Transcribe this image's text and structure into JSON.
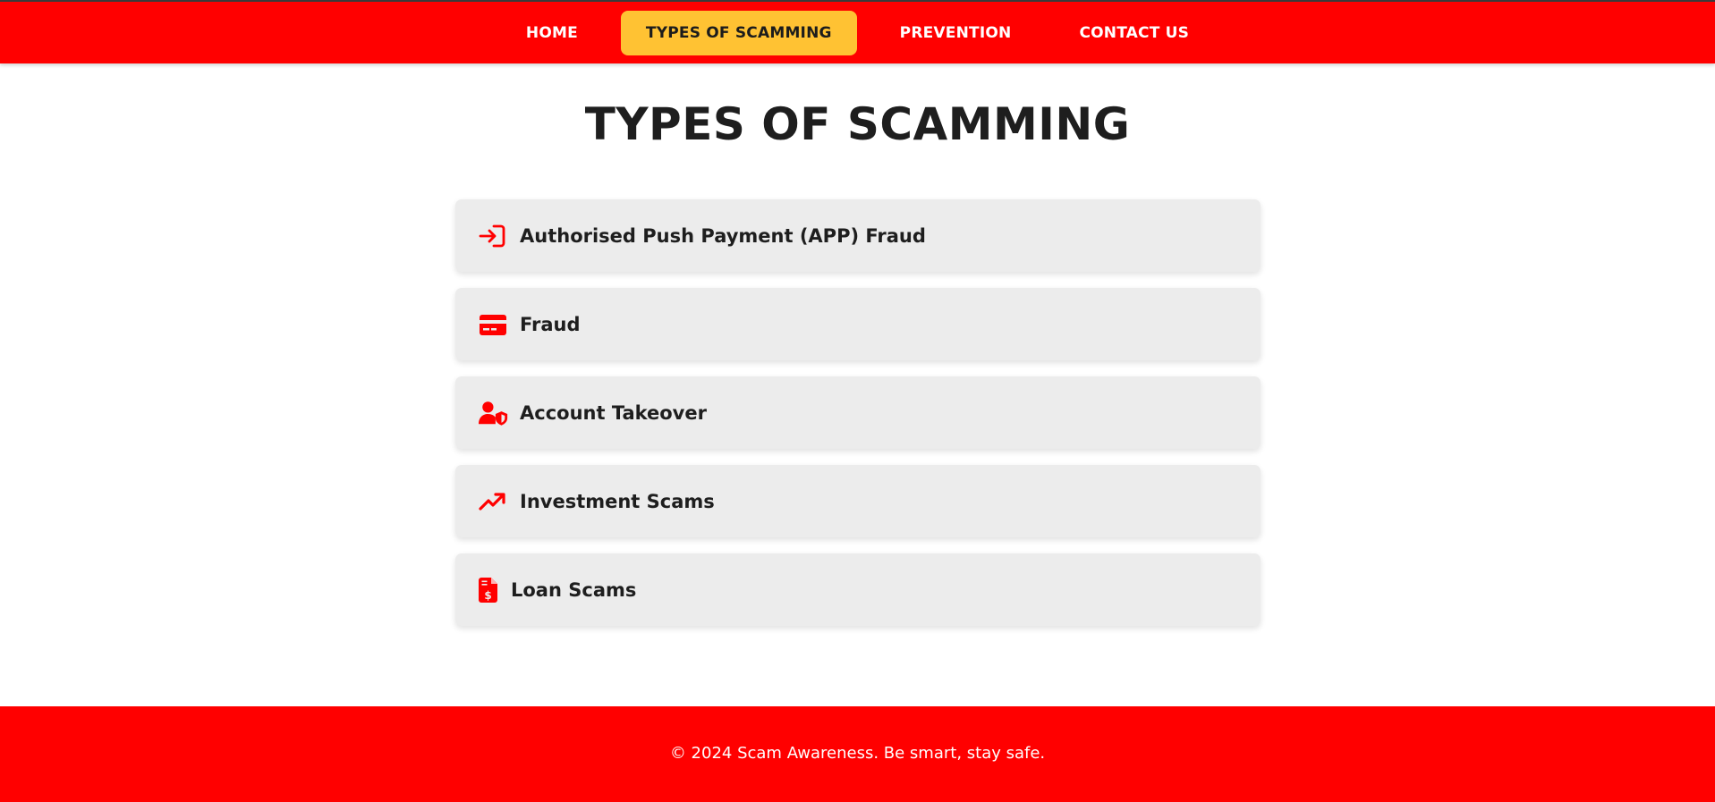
{
  "nav": {
    "items": [
      {
        "label": "HOME",
        "active": false
      },
      {
        "label": "TYPES OF SCAMMING",
        "active": true
      },
      {
        "label": "PREVENTION",
        "active": false
      },
      {
        "label": "CONTACT US",
        "active": false
      }
    ]
  },
  "main": {
    "title": "TYPES OF SCAMMING",
    "cards": [
      {
        "label": "Authorised Push Payment (APP) Fraud",
        "icon": "sign-in-arrow-icon"
      },
      {
        "label": "Fraud",
        "icon": "credit-card-icon"
      },
      {
        "label": "Account Takeover",
        "icon": "user-shield-icon"
      },
      {
        "label": "Investment Scams",
        "icon": "trending-up-icon"
      },
      {
        "label": "Loan Scams",
        "icon": "invoice-dollar-icon"
      }
    ]
  },
  "footer": {
    "text": "© 2024 Scam Awareness. Be smart, stay safe."
  },
  "colors": {
    "brand_red": "#ff0000",
    "active_yellow": "#ffc233",
    "card_bg": "#ececec",
    "text_dark": "#1e1e1e"
  }
}
